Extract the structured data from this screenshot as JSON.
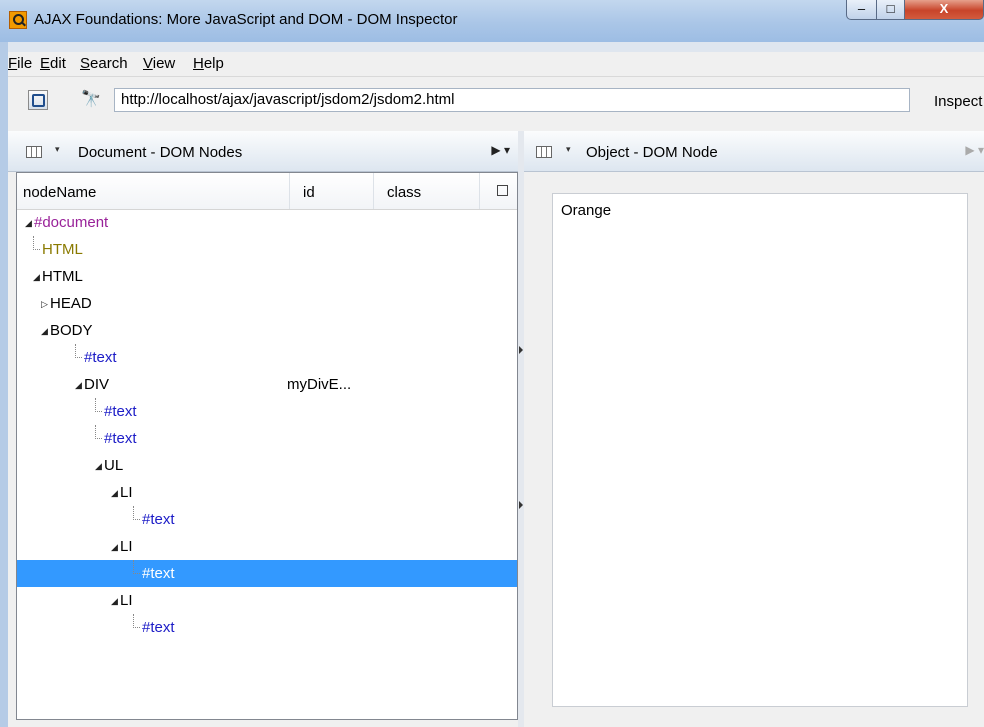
{
  "window": {
    "title": "AJAX Foundations: More JavaScript and DOM - DOM Inspector",
    "minimize": "–",
    "maximize": "□",
    "close": "X"
  },
  "menu": [
    "File",
    "Edit",
    "Search",
    "View",
    "Help"
  ],
  "toolbar": {
    "binoculars_glyph": "🔭",
    "url": "http://localhost/ajax/javascript/jsdom2/jsdom2.html",
    "inspect_label": "Inspect"
  },
  "left_pane": {
    "title": "Document - DOM Nodes",
    "columns": [
      "nodeName",
      "id",
      "class"
    ],
    "menu_glyph": "▶ ▾",
    "dropdown_glyph": "▾"
  },
  "tree": [
    {
      "label": "#document",
      "type": "doc",
      "expander": "open",
      "level": 0
    },
    {
      "label": "HTML",
      "type": "doctype",
      "expander": "leaf",
      "level": 1
    },
    {
      "label": "HTML",
      "type": "element",
      "expander": "open",
      "level": 1
    },
    {
      "label": "HEAD",
      "type": "element",
      "expander": "closed",
      "level": 2
    },
    {
      "label": "BODY",
      "type": "element",
      "expander": "open",
      "level": 2
    },
    {
      "label": "#text",
      "type": "text",
      "expander": "leaf",
      "level": 3
    },
    {
      "label": "DIV",
      "type": "element",
      "expander": "open",
      "level": 3,
      "id": "myDivE..."
    },
    {
      "label": "#text",
      "type": "text",
      "expander": "leaf",
      "level": 4
    },
    {
      "label": "#text",
      "type": "text",
      "expander": "leaf",
      "level": 4
    },
    {
      "label": "UL",
      "type": "element",
      "expander": "open",
      "level": 4
    },
    {
      "label": "LI",
      "type": "element",
      "expander": "open",
      "level": 5
    },
    {
      "label": "#text",
      "type": "text",
      "expander": "leaf",
      "level": 6
    },
    {
      "label": "LI",
      "type": "element",
      "expander": "open",
      "level": 5
    },
    {
      "label": "#text",
      "type": "text",
      "expander": "leaf",
      "level": 6,
      "selected": true
    },
    {
      "label": "LI",
      "type": "element",
      "expander": "open",
      "level": 5
    },
    {
      "label": "#text",
      "type": "text",
      "expander": "leaf",
      "level": 6
    }
  ],
  "right_pane": {
    "title": "Object - DOM Node",
    "value": "Orange",
    "menu_glyph": "▶ ▾",
    "dropdown_glyph": "▾"
  }
}
